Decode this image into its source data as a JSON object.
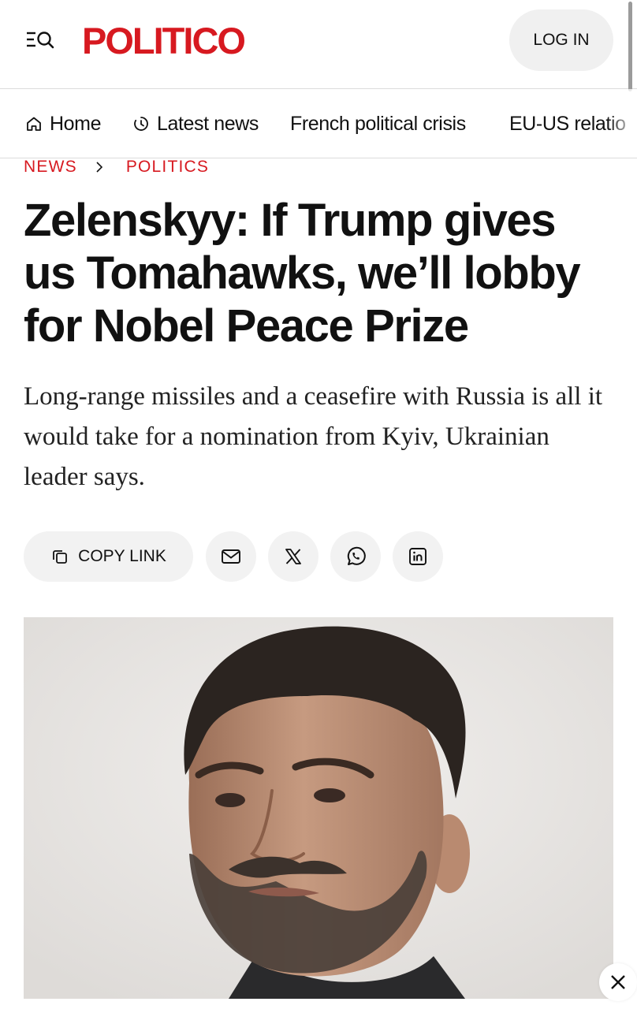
{
  "header": {
    "logo": "POLITICO",
    "login_label": "LOG IN"
  },
  "nav": {
    "items": [
      {
        "label": "Home",
        "icon": "home-icon"
      },
      {
        "label": "Latest news",
        "icon": "clock-icon"
      },
      {
        "label": "French political crisis"
      },
      {
        "label": "EU-US relatio"
      }
    ]
  },
  "breadcrumb": [
    "NEWS",
    "POLITICS"
  ],
  "article": {
    "headline": "Zelenskyy: If Trump gives us Tomahawks, we’ll lobby for Nobel Peace Prize",
    "dek": "Long-range missiles and a ceasefire with Russia is all it would take for a nomination from Kyiv, Ukrainian leader says."
  },
  "share": {
    "copy_label": "COPY LINK",
    "buttons": [
      "mail-icon",
      "x-icon",
      "whatsapp-icon",
      "linkedin-icon"
    ]
  },
  "colors": {
    "brand": "#d71920",
    "button_bg": "#f2f2f2"
  }
}
